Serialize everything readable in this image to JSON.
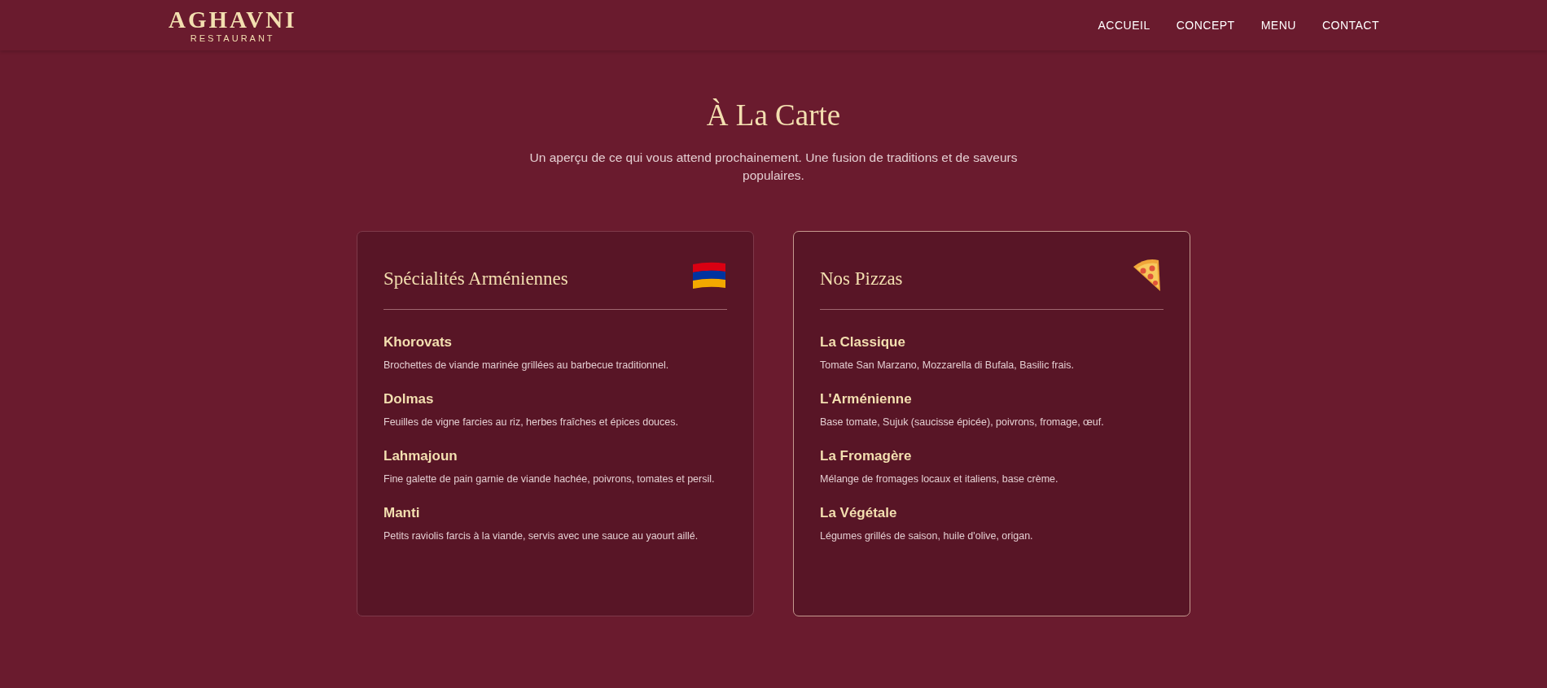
{
  "header": {
    "logo": "AGHAVNI",
    "logo_subtitle": "RESTAURANT",
    "nav": [
      {
        "label": "ACCUEIL"
      },
      {
        "label": "CONCEPT"
      },
      {
        "label": "MENU"
      },
      {
        "label": "CONTACT"
      }
    ]
  },
  "title": "À La Carte",
  "intro": "Un aperçu de ce qui vous attend prochainement. Une fusion de traditions et de saveurs populaires.",
  "cards": [
    {
      "title": "Spécialités Arméniennes",
      "highlighted": false,
      "items": [
        {
          "name": "Khorovats",
          "description": "Brochettes de viande marinée grillées au barbecue traditionnel."
        },
        {
          "name": "Dolmas",
          "description": "Feuilles de vigne farcies au riz, herbes fraîches et épices douces."
        },
        {
          "name": "Lahmajoun",
          "description": "Fine galette de pain garnie de viande hachée, poivrons, tomates et persil."
        },
        {
          "name": "Manti",
          "description": "Petits raviolis farcis à la viande, servis avec une sauce au yaourt aillé."
        }
      ]
    },
    {
      "title": "Nos Pizzas",
      "highlighted": true,
      "items": [
        {
          "name": "La Classique",
          "description": "Tomate San Marzano, Mozzarella di Bufala, Basilic frais."
        },
        {
          "name": "L'Arménienne",
          "description": "Base tomate, Sujuk (saucisse épicée), poivrons, fromage, œuf."
        },
        {
          "name": "La Fromagère",
          "description": "Mélange de fromages locaux et italiens, base crème."
        },
        {
          "name": "La Végétale",
          "description": "Légumes grillés de saison, huile d'olive, origan."
        }
      ]
    }
  ]
}
